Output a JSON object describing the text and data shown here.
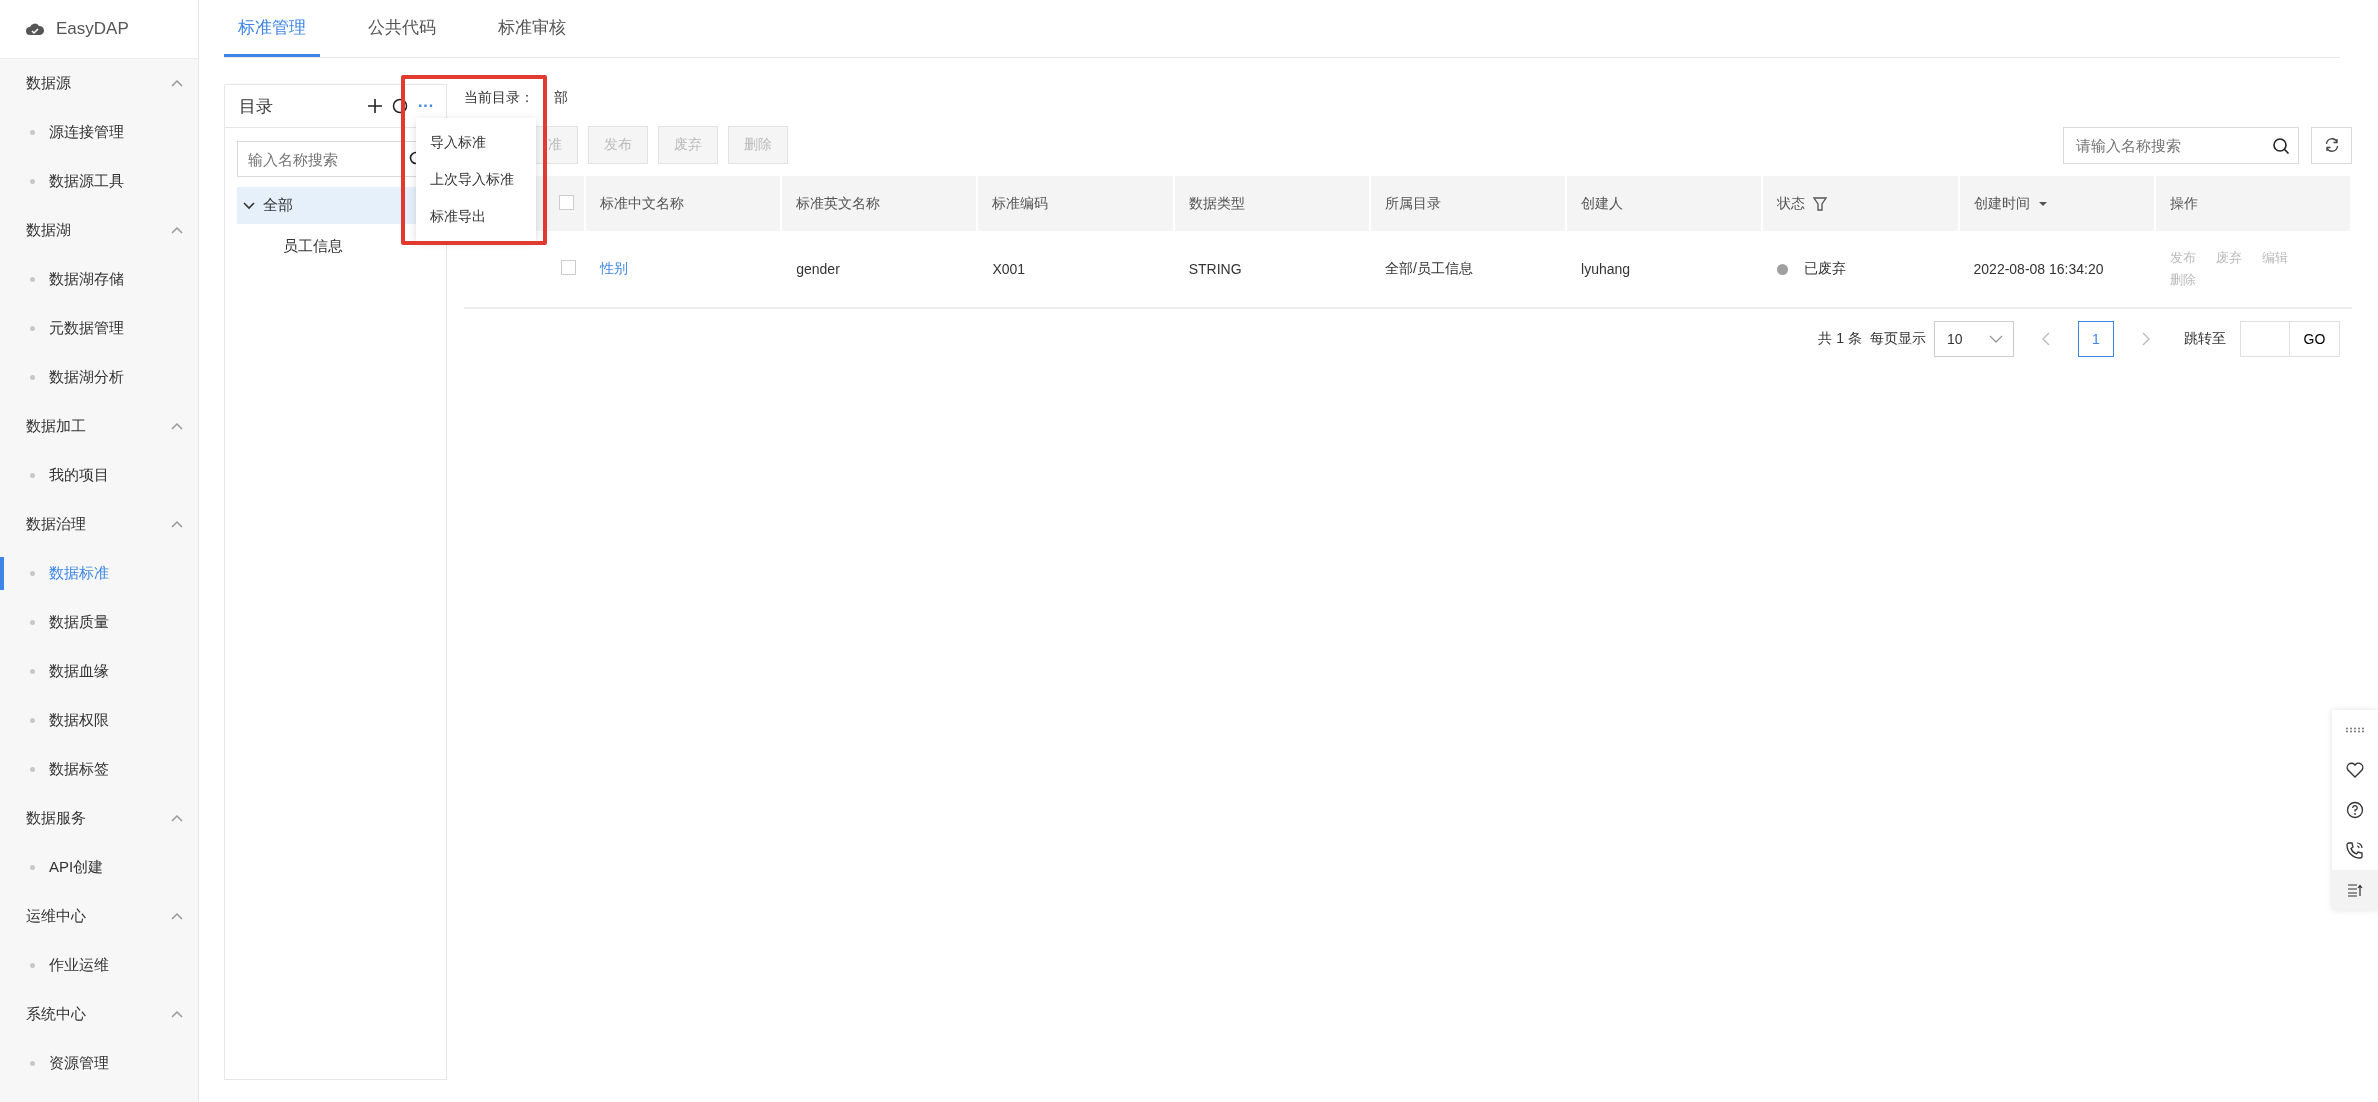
{
  "sidebar": {
    "brand": "EasyDAP",
    "groups": [
      {
        "label": "数据源",
        "expanded": true,
        "children": [
          {
            "label": "源连接管理",
            "selected": false
          },
          {
            "label": "数据源工具",
            "selected": false
          }
        ]
      },
      {
        "label": "数据湖",
        "expanded": true,
        "children": [
          {
            "label": "数据湖存储",
            "selected": false
          },
          {
            "label": "元数据管理",
            "selected": false
          },
          {
            "label": "数据湖分析",
            "selected": false
          }
        ]
      },
      {
        "label": "数据加工",
        "expanded": true,
        "children": [
          {
            "label": "我的项目",
            "selected": false
          }
        ]
      },
      {
        "label": "数据治理",
        "expanded": true,
        "children": [
          {
            "label": "数据标准",
            "selected": true
          },
          {
            "label": "数据质量",
            "selected": false
          },
          {
            "label": "数据血缘",
            "selected": false
          },
          {
            "label": "数据权限",
            "selected": false
          },
          {
            "label": "数据标签",
            "selected": false
          }
        ]
      },
      {
        "label": "数据服务",
        "expanded": true,
        "children": [
          {
            "label": "API创建",
            "selected": false
          }
        ]
      },
      {
        "label": "运维中心",
        "expanded": true,
        "children": [
          {
            "label": "作业运维",
            "selected": false
          }
        ]
      },
      {
        "label": "系统中心",
        "expanded": true,
        "children": [
          {
            "label": "资源管理",
            "selected": false
          }
        ]
      }
    ]
  },
  "tabs": [
    {
      "label": "标准管理",
      "selected": true
    },
    {
      "label": "公共代码",
      "selected": false
    },
    {
      "label": "标准审核",
      "selected": false
    }
  ],
  "tree_panel": {
    "title": "目录",
    "more": "···",
    "search": {
      "placeholder": "输入名称搜索"
    },
    "nodes": [
      {
        "label": "全部",
        "expanded": true,
        "selected": true,
        "children": [
          {
            "label": "员工信息",
            "selected": false
          }
        ]
      }
    ]
  },
  "dropdown_menu": {
    "items": [
      "导入标准",
      "上次导入标准",
      "标准导出"
    ]
  },
  "current_dir": {
    "label": "当前目录：",
    "value": "部"
  },
  "toolbar": {
    "buttons": [
      {
        "label": "准",
        "disabled": true
      },
      {
        "label": "发布",
        "disabled": true
      },
      {
        "label": "废弃",
        "disabled": true
      },
      {
        "label": "删除",
        "disabled": true
      }
    ],
    "search": {
      "placeholder": "请输入名称搜索"
    }
  },
  "table": {
    "select_all": {
      "checked": false
    },
    "columns": [
      {
        "kind": "checkbox"
      },
      {
        "label": "标准中文名称",
        "kind": "plain"
      },
      {
        "label": "标准英文名称",
        "kind": "plain"
      },
      {
        "label": "标准编码",
        "kind": "plain"
      },
      {
        "label": "数据类型",
        "kind": "plain"
      },
      {
        "label": "所属目录",
        "kind": "plain"
      },
      {
        "label": "创建人",
        "kind": "plain"
      },
      {
        "label": "状态",
        "kind": "filter"
      },
      {
        "label": "创建时间",
        "kind": "sort"
      },
      {
        "label": "操作",
        "kind": "plain"
      }
    ],
    "rows": [
      {
        "checked": false,
        "name_cn": "性别",
        "name_en": "gender",
        "code": "X001",
        "type": "STRING",
        "dir": "全部/员工信息",
        "creator": "lyuhang",
        "status": {
          "label": "已废弃",
          "color": "#a0a0a0"
        },
        "created": "2022-08-08 16:34:20",
        "actions": [
          {
            "label": "发布",
            "disabled": true
          },
          {
            "label": "废弃",
            "disabled": true
          },
          {
            "label": "编辑",
            "disabled": true
          },
          {
            "label": "删除",
            "disabled": true
          }
        ]
      }
    ]
  },
  "pagination": {
    "total": "共 1 条",
    "page_size_label": "每页显示",
    "page_size": "10",
    "pages": [
      {
        "label": "1",
        "selected": true
      }
    ],
    "jump_label": "跳转至",
    "go": "GO"
  }
}
